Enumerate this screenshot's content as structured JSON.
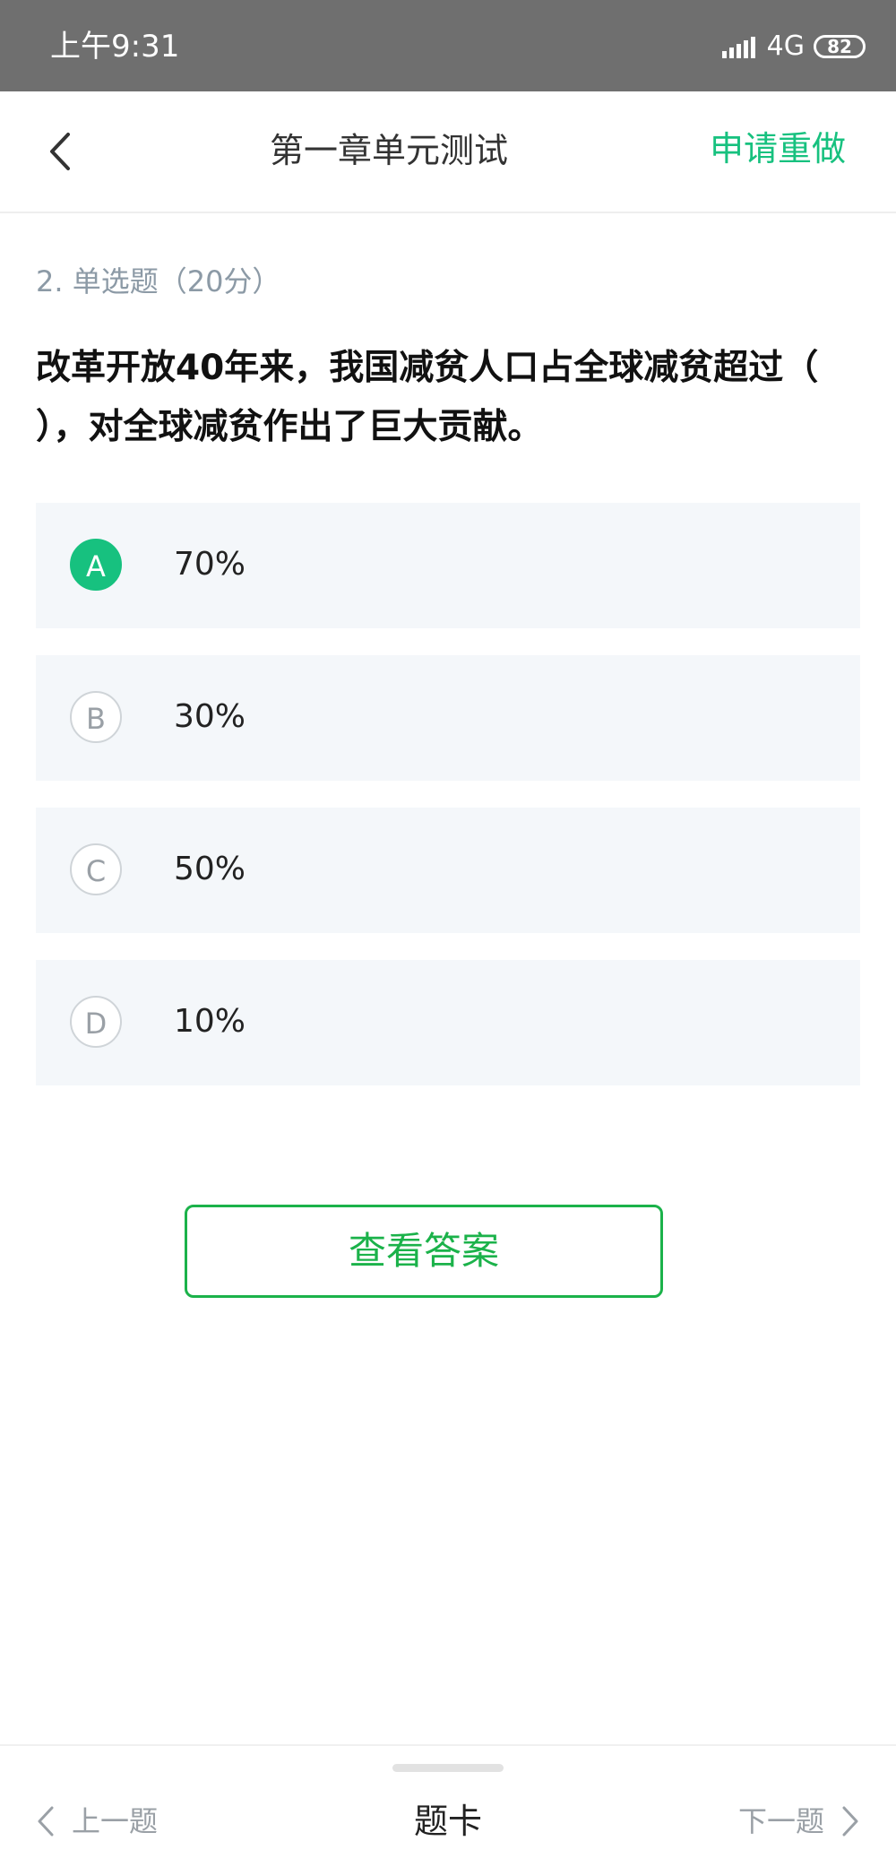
{
  "status_bar": {
    "time": "上午9:31",
    "network": "4G",
    "battery": "82"
  },
  "header": {
    "title": "第一章单元测试",
    "redo_label": "申请重做",
    "back_icon": "chevron-left-icon"
  },
  "question": {
    "meta": "2. 单选题（20分）",
    "text": "改革开放40年来，我国减贫人口占全球减贫超过（ ），对全球减贫作出了巨大贡献。",
    "selected": "A"
  },
  "options": [
    {
      "letter": "A",
      "text": "70%"
    },
    {
      "letter": "B",
      "text": "30%"
    },
    {
      "letter": "C",
      "text": "50%"
    },
    {
      "letter": "D",
      "text": "10%"
    }
  ],
  "view_answer_label": "查看答案",
  "footer": {
    "prev_label": "上一题",
    "card_label": "题卡",
    "next_label": "下一题"
  },
  "colors": {
    "accent": "#17c17f",
    "answer_button": "#1bb24a",
    "option_bg": "#f4f7fa"
  }
}
